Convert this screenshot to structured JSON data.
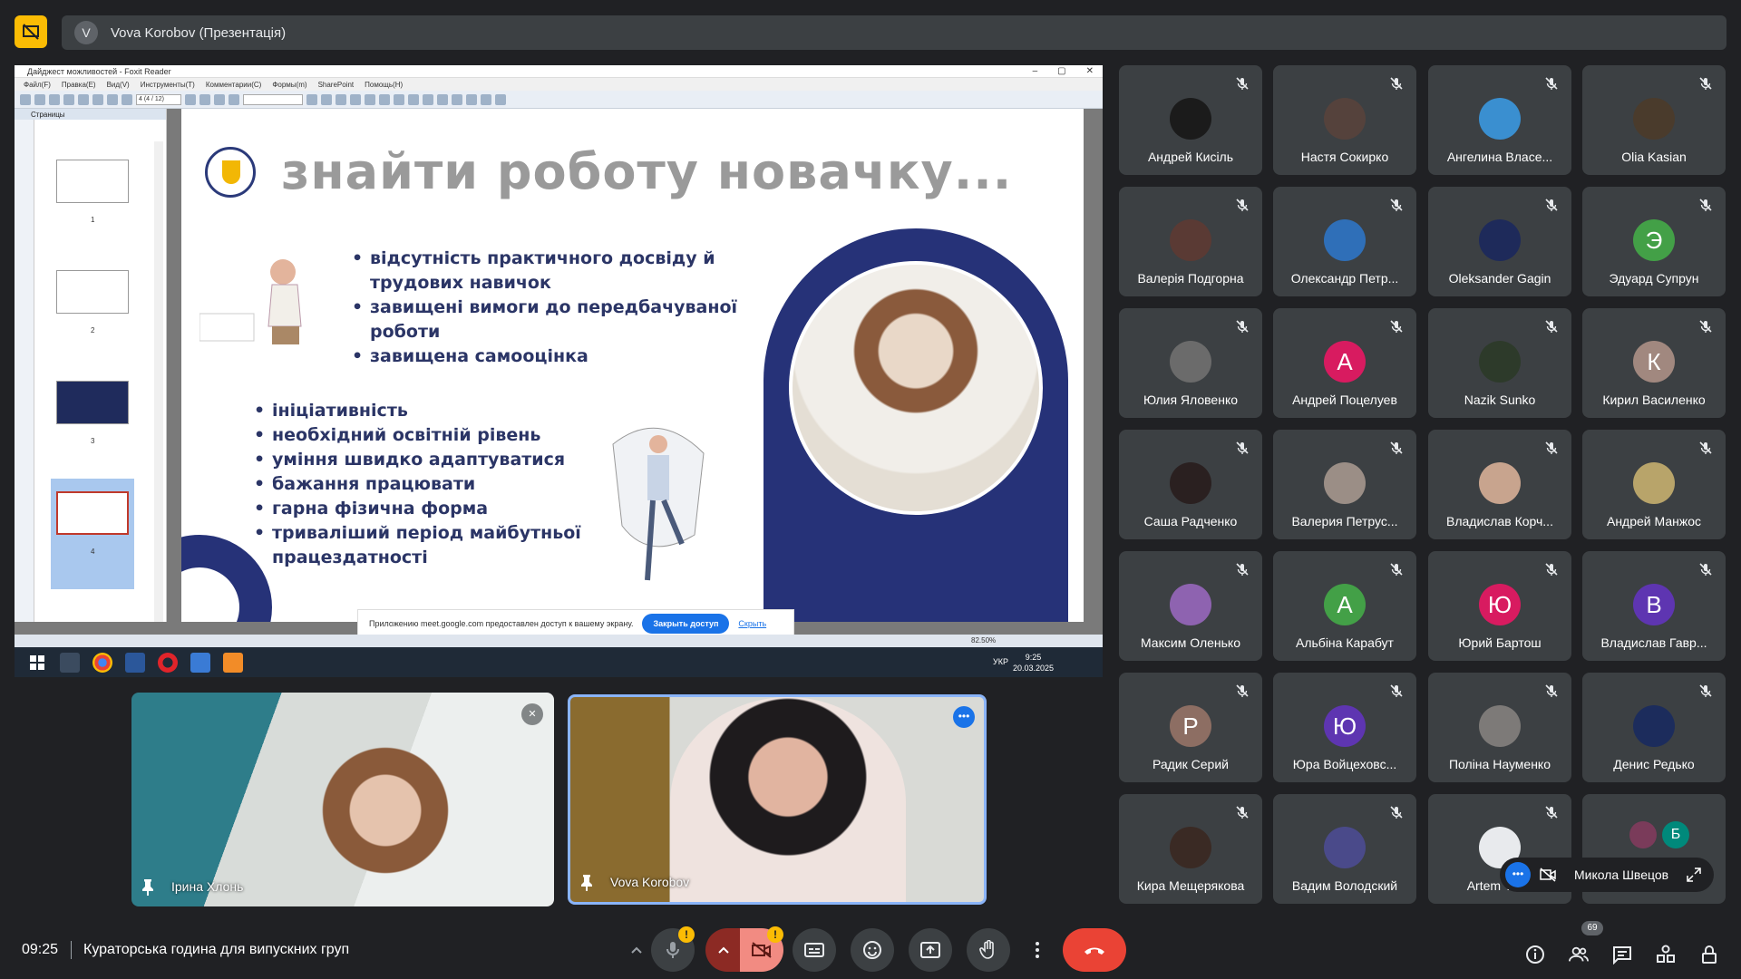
{
  "presentation_bar": {
    "avatar_letter": "V",
    "title": "Vova Korobov (Презентація)"
  },
  "foxit": {
    "window_title": "Дайджест можливостей - Foxit Reader",
    "menu": [
      "Файл(F)",
      "Правка(E)",
      "Вид(V)",
      "Инструменты(T)",
      "Комментарии(C)",
      "Формы(m)",
      "SharePoint",
      "Помощь(H)"
    ],
    "page_field": "4 (4 / 12)",
    "pages_panel_title": "Страницы",
    "thumb_numbers": [
      "1",
      "2",
      "3",
      "4"
    ],
    "zoom": "82.50%",
    "share_notice": "Приложению meet.google.com предоставлен доступ к вашему экрану.",
    "share_stop": "Закрыть доступ",
    "share_hide": "Скрыть"
  },
  "slide": {
    "title": "знайти роботу новачку...",
    "bullets_1": [
      "відсутність практичного досвіду й трудових навичок",
      "завищені вимоги до передбачуваної роботи",
      "завищена самооцінка"
    ],
    "bullets_2": [
      "ініціативність",
      "необхідний освітній рівень",
      "уміння швидко адаптуватися",
      "бажання працювати",
      "гарна фізична форма",
      "триваліший період майбутньої працездатності"
    ]
  },
  "taskbar": {
    "lang": "УКР",
    "time": "9:25",
    "date": "20.03.2025"
  },
  "tiles": [
    {
      "name": "Ірина Хлонь"
    },
    {
      "name": "Vova Korobov"
    }
  ],
  "participants": [
    {
      "name": "Андрей Кисіль",
      "letter": "",
      "color": "#1b1b1b"
    },
    {
      "name": "Настя Сокирко",
      "letter": "",
      "color": "#55423c"
    },
    {
      "name": "Ангелина Власе...",
      "letter": "",
      "color": "#3a8fd0"
    },
    {
      "name": "Olia Kasian",
      "letter": "",
      "color": "#4a3b2c"
    },
    {
      "name": "Валерія Подгорна",
      "letter": "",
      "color": "#5a3a34"
    },
    {
      "name": "Олександр Петр...",
      "letter": "",
      "color": "#2f6fb8"
    },
    {
      "name": "Oleksander Gagin",
      "letter": "",
      "color": "#1e2a5a"
    },
    {
      "name": "Эдуард Супрун",
      "letter": "Э",
      "color": "#43a047"
    },
    {
      "name": "Юлия Яловенко",
      "letter": "",
      "color": "#6b6b6b"
    },
    {
      "name": "Андрей Поцелуев",
      "letter": "А",
      "color": "#d81b60"
    },
    {
      "name": "Nazik Sunko",
      "letter": "",
      "color": "#2d3a2a"
    },
    {
      "name": "Кирил Василенко",
      "letter": "К",
      "color": "#a1887f"
    },
    {
      "name": "Саша Радченко",
      "letter": "",
      "color": "#2a2020"
    },
    {
      "name": "Валерия Петрус...",
      "letter": "",
      "color": "#9b8e86"
    },
    {
      "name": "Владислав Корч...",
      "letter": "",
      "color": "#c8a48e"
    },
    {
      "name": "Андрей Манжос",
      "letter": "",
      "color": "#b8a46a"
    },
    {
      "name": "Максим Оленько",
      "letter": "",
      "color": "#8e63b0"
    },
    {
      "name": "Альбіна Карабут",
      "letter": "А",
      "color": "#43a047"
    },
    {
      "name": "Юрий Бартош",
      "letter": "Ю",
      "color": "#d81b60"
    },
    {
      "name": "Владислав Гавр...",
      "letter": "В",
      "color": "#5e35b1"
    },
    {
      "name": "Радик Серий",
      "letter": "Р",
      "color": "#8d6e63"
    },
    {
      "name": "Юра Войцеховс...",
      "letter": "Ю",
      "color": "#5e35b1"
    },
    {
      "name": "Поліна Науменко",
      "letter": "",
      "color": "#7d7a78"
    },
    {
      "name": "Денис Редько",
      "letter": "",
      "color": "#1c2c5c"
    },
    {
      "name": "Кира Мещерякова",
      "letter": "",
      "color": "#3a2a24"
    },
    {
      "name": "Вадим Володский",
      "letter": "",
      "color": "#4a4a8a"
    },
    {
      "name": "Artem Yar...",
      "letter": "",
      "color": "#e8eaed"
    },
    {
      "name": "",
      "letter": "Б",
      "color": "#00897b"
    }
  ],
  "mini_tile": {
    "name": "Микола Швецов"
  },
  "bottom_bar": {
    "time": "09:25",
    "meeting_title": "Кураторська година для випускних груп",
    "participant_count": "69",
    "badge": "!"
  }
}
